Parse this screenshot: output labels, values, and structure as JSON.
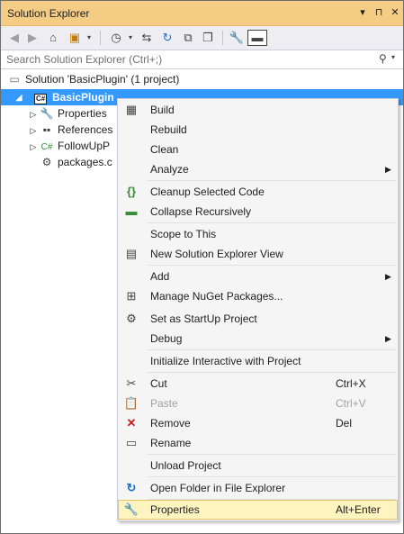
{
  "window": {
    "title": "Solution Explorer"
  },
  "title_buttons": {
    "dropdown": "▾",
    "pin": "⊓",
    "close": "✕"
  },
  "search": {
    "placeholder": "Search Solution Explorer (Ctrl+;)"
  },
  "tree": {
    "solution": "Solution 'BasicPlugin' (1 project)",
    "project": "BasicPlugin",
    "project_badge": "C#",
    "properties": "Properties",
    "references": "References",
    "followup": "FollowUpP",
    "followup_badge": "C#",
    "packages": "packages.c"
  },
  "menu": {
    "build": "Build",
    "rebuild": "Rebuild",
    "clean": "Clean",
    "analyze": "Analyze",
    "cleanup": "Cleanup Selected Code",
    "collapse": "Collapse Recursively",
    "scope": "Scope to This",
    "new_view": "New Solution Explorer View",
    "add": "Add",
    "nuget": "Manage NuGet Packages...",
    "startup": "Set as StartUp Project",
    "debug": "Debug",
    "interactive": "Initialize Interactive with Project",
    "cut": "Cut",
    "cut_shortcut": "Ctrl+X",
    "paste": "Paste",
    "paste_shortcut": "Ctrl+V",
    "remove": "Remove",
    "remove_shortcut": "Del",
    "rename": "Rename",
    "unload": "Unload Project",
    "open_folder": "Open Folder in File Explorer",
    "properties": "Properties",
    "properties_shortcut": "Alt+Enter"
  },
  "colors": {
    "title_bar": "#f5cc84",
    "selection": "#3399ff",
    "menu_highlight": "#fdf4bf"
  }
}
